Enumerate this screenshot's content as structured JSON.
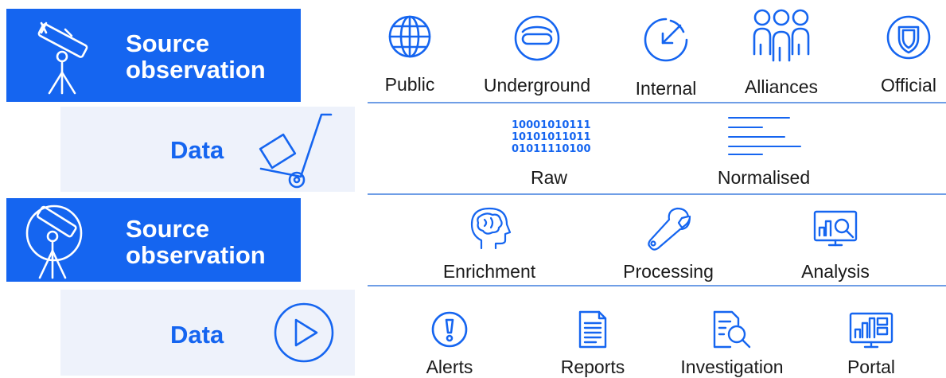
{
  "rows": {
    "source1": {
      "title_line1": "Source",
      "title_line2": "observation"
    },
    "data1": {
      "title": "Data"
    },
    "source2": {
      "title_line1": "Source",
      "title_line2": "observation"
    },
    "data2": {
      "title": "Data"
    }
  },
  "sources": [
    "Public",
    "Underground",
    "Internal",
    "Alliances",
    "Official"
  ],
  "data_types": {
    "raw_label": "Raw",
    "normalised_label": "Normalised",
    "binary_lines": [
      "10001010111",
      "10101011011",
      "01011110100"
    ]
  },
  "processing": [
    "Enrichment",
    "Processing",
    "Analysis"
  ],
  "outputs": [
    "Alerts",
    "Reports",
    "Investigation",
    "Portal"
  ],
  "colors": {
    "accent": "#1565f0",
    "panel": "#eef2fb",
    "rule": "#6f9ee6",
    "text": "#1a1a1a"
  },
  "icons": {
    "source1": "telescope-icon",
    "data1": "hand-truck-icon",
    "source2": "telescope-circle-icon",
    "data2": "play-circle-icon",
    "sources": [
      "globe-icon",
      "minus-circle-icon",
      "internal-arrow-icon",
      "people-group-icon",
      "shield-icon"
    ],
    "data_types": [
      "binary-icon",
      "text-lines-icon"
    ],
    "processing": [
      "brain-head-icon",
      "wrench-icon",
      "monitor-magnifier-icon"
    ],
    "outputs": [
      "exclamation-circle-icon",
      "document-icon",
      "document-search-icon",
      "monitor-chart-icon"
    ]
  }
}
